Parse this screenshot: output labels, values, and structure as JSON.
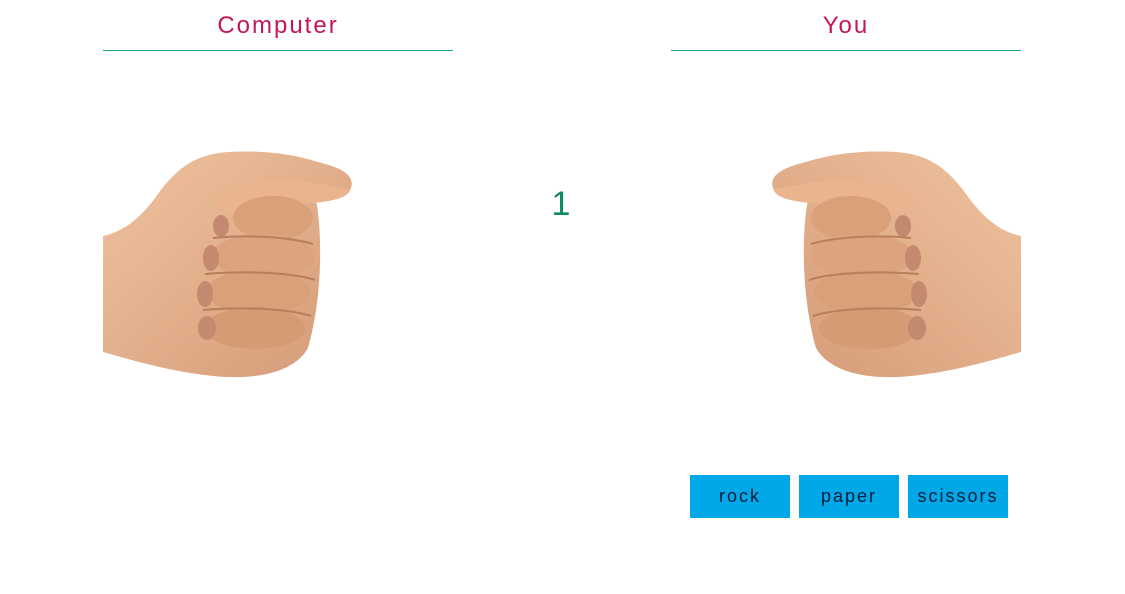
{
  "colors": {
    "title": "#c2185b",
    "divider": "#1aa88a",
    "counter": "#0e8a5f",
    "button_bg": "#00a8e8",
    "button_text": "#0d1b3a",
    "skin": "#e8b48f",
    "skin_shadow": "#c98e6a"
  },
  "computer": {
    "title": "Computer",
    "hand_icon": "fist-icon"
  },
  "player": {
    "title": "You",
    "hand_icon": "fist-icon"
  },
  "countdown": {
    "value": "1"
  },
  "choices": [
    {
      "label": "rock"
    },
    {
      "label": "paper"
    },
    {
      "label": "scissors"
    }
  ]
}
